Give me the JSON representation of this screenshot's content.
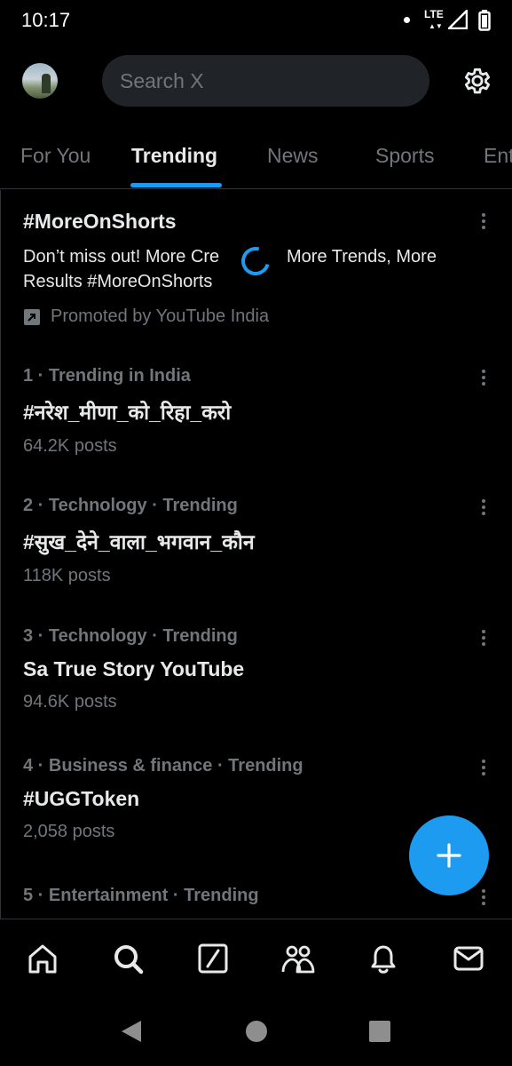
{
  "status_bar": {
    "time": "10:17",
    "network": "LTE"
  },
  "search": {
    "placeholder": "Search X"
  },
  "tabs": [
    {
      "label": "For You"
    },
    {
      "label": "Trending"
    },
    {
      "label": "News"
    },
    {
      "label": "Sports"
    },
    {
      "label": "Ent"
    }
  ],
  "active_tab": "Trending",
  "promoted": {
    "title": "#MoreOnShorts",
    "desc_part1": "Don’t miss out! More Cre",
    "desc_part2": "More Trends, More",
    "desc_part3": "Results #MoreOnShorts",
    "promoted_by": "Promoted by YouTube India"
  },
  "trends": [
    {
      "meta": "1 · Trending in India",
      "name": "#नरेश_मीणा_को_रिहा_करो",
      "count": "64.2K posts"
    },
    {
      "meta": "2 · Technology · Trending",
      "name": "#सुख_देने_वाला_भगवान_कौन",
      "count": "118K posts"
    },
    {
      "meta": "3 · Technology · Trending",
      "name": "Sa True Story YouTube",
      "count": "94.6K posts"
    },
    {
      "meta": "4 · Business & finance · Trending",
      "name": "#UGGToken",
      "count": "2,058 posts"
    },
    {
      "meta": "5 · Entertainment · Trending",
      "name": "",
      "count": ""
    }
  ],
  "colors": {
    "accent": "#1d9bf0",
    "background": "#000000",
    "muted_text": "#71767b",
    "primary_text": "#e7e9ea",
    "divider": "#2f3336"
  },
  "icons": {
    "topbar": [
      "avatar",
      "gear-icon"
    ],
    "bottom_nav": [
      "home-icon",
      "search-icon",
      "grok-icon",
      "communities-icon",
      "notifications-icon",
      "messages-icon"
    ],
    "system_nav": [
      "back-icon",
      "home-circle-icon",
      "recents-icon"
    ],
    "fab": "plus-icon"
  }
}
